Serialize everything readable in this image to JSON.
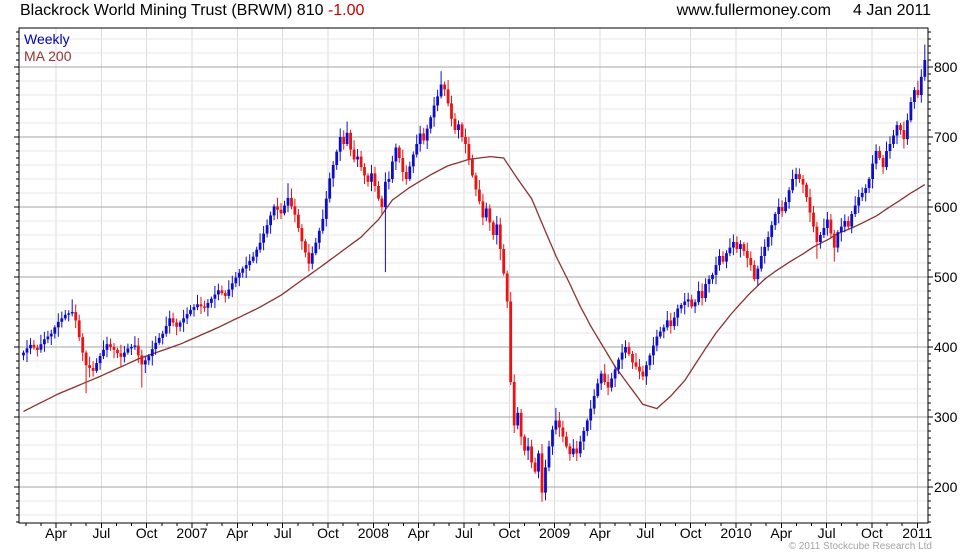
{
  "header": {
    "title_main": "Blackrock World Mining Trust (BRWM) 810 ",
    "title_change": "-1.00",
    "website": "www.fullermoney.com",
    "date": "4 Jan 2011"
  },
  "legend": {
    "weekly": "Weekly",
    "ma": "MA 200"
  },
  "footer": {
    "copyright": "© 2011 Stockcube Research Ltd"
  },
  "colors": {
    "up_candle": "#0d0dd0",
    "down_candle": "#ee1111",
    "ma_line": "#8b3030",
    "grid_minor": "#e7e7e7",
    "grid_major": "#a6a6a6",
    "grid_vertical": "#dcdcdc",
    "axis": "#000000",
    "legend_weekly": "#0000bb",
    "legend_ma": "#993333",
    "title_change": "#cc0000",
    "copyright": "#a3a3a3"
  },
  "chart_data": {
    "type": "candlestick",
    "title": "Blackrock World Mining Trust (BRWM)",
    "interval": "Weekly",
    "overlay": "MA 200",
    "last_price": 810,
    "change": -1.0,
    "date_of_quote": "4 Jan 2011",
    "y_axis": {
      "tick_labels": [
        "800",
        "700",
        "600",
        "500",
        "400",
        "300",
        "200"
      ],
      "tick_values": [
        800,
        700,
        600,
        500,
        400,
        300,
        200
      ],
      "minor_tick_step": 10,
      "grid_minor_step": 20,
      "visible_range": [
        149,
        856
      ]
    },
    "x_axis": {
      "quarter_labels": [
        "Apr",
        "Jul",
        "Oct",
        "2007",
        "Apr",
        "Jul",
        "Oct",
        "2008",
        "Apr",
        "Jul",
        "Oct",
        "2009",
        "Apr",
        "Jul",
        "Oct",
        "2010",
        "Apr",
        "Jul",
        "Oct",
        "2011"
      ],
      "start": "early 2006",
      "end": "Jan 2011",
      "weeks": 260
    },
    "weekly_closes": [
      392,
      398,
      403,
      399,
      396,
      404,
      411,
      415,
      419,
      428,
      436,
      441,
      446,
      448,
      450,
      438,
      414,
      392,
      374,
      370,
      366,
      377,
      387,
      396,
      404,
      400,
      396,
      391,
      386,
      392,
      398,
      400,
      402,
      388,
      375,
      381,
      387,
      397,
      406,
      413,
      419,
      430,
      441,
      435,
      429,
      435,
      441,
      447,
      453,
      457,
      461,
      458,
      456,
      463,
      469,
      475,
      481,
      477,
      473,
      482,
      491,
      499,
      506,
      512,
      517,
      523,
      529,
      539,
      549,
      562,
      574,
      588,
      601,
      596,
      591,
      602,
      613,
      601,
      589,
      570,
      551,
      535,
      519,
      534,
      549,
      566,
      583,
      612,
      641,
      660,
      679,
      700,
      690,
      706,
      682,
      668,
      672,
      657,
      645,
      636,
      648,
      630,
      612,
      600,
      636,
      640,
      665,
      685,
      670,
      650,
      640,
      658,
      675,
      690,
      705,
      695,
      712,
      728,
      745,
      758,
      775,
      768,
      748,
      726,
      710,
      718,
      700,
      690,
      668,
      645,
      625,
      608,
      585,
      598,
      578,
      560,
      575,
      540,
      505,
      465,
      350,
      288,
      306,
      272,
      252,
      258,
      235,
      222,
      248,
      192,
      228,
      258,
      282,
      295,
      285,
      272,
      258,
      247,
      255,
      248,
      265,
      280,
      295,
      312,
      330,
      348,
      362,
      350,
      342,
      355,
      368,
      382,
      392,
      400,
      390,
      378,
      372,
      365,
      358,
      374,
      388,
      402,
      415,
      422,
      428,
      438,
      430,
      442,
      455,
      460,
      465,
      468,
      458,
      464,
      480,
      470,
      490,
      497,
      503,
      517,
      530,
      522,
      534,
      542,
      550,
      540,
      547,
      537,
      527,
      517,
      497,
      512,
      530,
      543,
      557,
      574,
      590,
      600,
      594,
      607,
      624,
      640,
      647,
      640,
      632,
      614,
      592,
      572,
      550,
      560,
      570,
      582,
      562,
      542,
      564,
      572,
      580,
      572,
      590,
      602,
      614,
      620,
      627,
      640,
      662,
      680,
      670,
      657,
      680,
      690,
      702,
      717,
      710,
      697,
      724,
      750,
      767,
      760,
      786,
      810
    ],
    "wick_overrides": {
      "14": {
        "high": 468
      },
      "18": {
        "low": 334
      },
      "34": {
        "low": 342
      },
      "76": {
        "high": 634
      },
      "82": {
        "low": 508
      },
      "93": {
        "high": 722
      },
      "104": {
        "low": 507
      },
      "120": {
        "high": 794
      },
      "137": {
        "low": 524
      },
      "149": {
        "low": 179
      },
      "153": {
        "high": 313
      },
      "222": {
        "high": 656
      },
      "228": {
        "low": 526
      },
      "233": {
        "low": 522
      },
      "259": {
        "high": 832
      }
    },
    "ma200_anchors": [
      [
        0,
        308
      ],
      [
        10,
        333
      ],
      [
        22,
        358
      ],
      [
        33,
        383
      ],
      [
        45,
        404
      ],
      [
        56,
        428
      ],
      [
        68,
        457
      ],
      [
        74,
        474
      ],
      [
        79,
        492
      ],
      [
        85,
        513
      ],
      [
        91,
        535
      ],
      [
        97,
        557
      ],
      [
        102,
        582
      ],
      [
        106,
        610
      ],
      [
        111,
        628
      ],
      [
        117,
        646
      ],
      [
        122,
        659
      ],
      [
        128,
        668
      ],
      [
        134,
        672
      ],
      [
        138,
        670
      ],
      [
        142,
        640
      ],
      [
        146,
        612
      ],
      [
        150,
        565
      ],
      [
        153,
        530
      ],
      [
        157,
        490
      ],
      [
        160,
        458
      ],
      [
        163,
        430
      ],
      [
        166,
        405
      ],
      [
        170,
        372
      ],
      [
        174,
        345
      ],
      [
        178,
        318
      ],
      [
        182,
        312
      ],
      [
        186,
        330
      ],
      [
        190,
        352
      ],
      [
        193,
        375
      ],
      [
        196,
        398
      ],
      [
        199,
        420
      ],
      [
        203,
        445
      ],
      [
        206,
        462
      ],
      [
        209,
        478
      ],
      [
        213,
        497
      ],
      [
        216,
        508
      ],
      [
        220,
        521
      ],
      [
        224,
        533
      ],
      [
        227,
        543
      ],
      [
        231,
        553
      ],
      [
        234,
        562
      ],
      [
        238,
        570
      ],
      [
        241,
        577
      ],
      [
        245,
        587
      ],
      [
        248,
        597
      ],
      [
        252,
        610
      ],
      [
        255,
        620
      ],
      [
        258,
        629
      ],
      [
        259,
        632
      ]
    ]
  }
}
